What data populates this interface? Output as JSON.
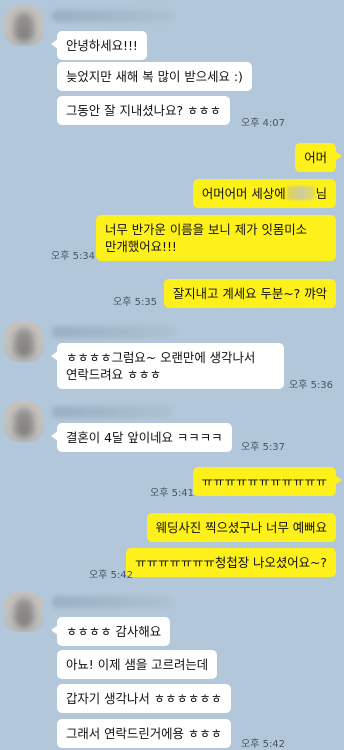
{
  "messages": {
    "m1": "안녕하세요!!!",
    "m2": "늦었지만 새해 복 많이 받으세요 :)",
    "m3": "그동안 잘 지내셨나요? ㅎㅎㅎ",
    "m4": "어머",
    "m5_pre": "어머어머 세상에",
    "m5_post": "님",
    "m6_l1": "너무 반가운 이름을 보니 제가 잇몸미소",
    "m6_l2": "만개했어요!!!",
    "m7": "잘지내고 계세요 두분~? 꺄악",
    "m8_l1": "ㅎㅎㅎㅎ그럼요~ 오랜만에 생각나서",
    "m8_l2": "연락드려요 ㅎㅎㅎ",
    "m9": "결혼이 4달 앞이네요 ㅋㅋㅋㅋ",
    "m10": "ㅠㅠㅠㅠㅠㅠㅠㅠㅠㅠㅠ",
    "m11": "웨딩사진 찍으셨구나 너무 예뻐요",
    "m12": "ㅠㅠㅠㅠㅠㅠㅠ청첩장 나오셨어요~?",
    "m13": "ㅎㅎㅎㅎ 감사해요",
    "m14": "아뇨! 이제 샘을 고르려는데",
    "m15": "갑자기 생각나서 ㅎㅎㅎㅎㅎㅎ",
    "m16": "그래서 연락드린거에용 ㅎㅎㅎ"
  },
  "times": {
    "t1": "오후 4:07",
    "t2": "오후 5:34",
    "t3": "오후 5:35",
    "t4": "오후 5:36",
    "t5": "오후 5:37",
    "t6": "오후 5:41",
    "t7": "오후 5:42",
    "t8": "오후 5:42"
  },
  "colors": {
    "background": "#b2c7d9",
    "incoming_bubble": "#ffffff",
    "outgoing_bubble": "#fef01b"
  }
}
